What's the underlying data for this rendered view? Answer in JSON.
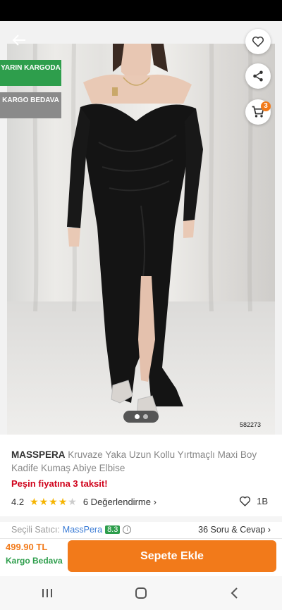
{
  "product": {
    "image_code": "582273",
    "brand": "MASSPERA",
    "name": "Kruvaze Yaka Uzun Kollu Yırtmaçlı Maxi Boy Kadife Kumaş Abiye Elbise",
    "installment_note": "Peşin fiyatına 3 taksit!",
    "rating": "4.2",
    "stars_filled": 4,
    "stars_total": 5,
    "review_count_label": "6 Değerlendirme",
    "favorites": "1B",
    "seller_label": "Seçili Satıcı:",
    "seller_name": "MassPera",
    "seller_score": "8.3",
    "qa_label": "36 Soru & Cevap"
  },
  "badges": {
    "fast_delivery": "YARIN KARGODA",
    "free_shipping": "KARGO BEDAVA"
  },
  "cart": {
    "count": "3"
  },
  "gallery": {
    "total": 2,
    "active_index": 0
  },
  "purchase": {
    "price": "499.90 TL",
    "shipping": "Kargo Bedava",
    "add_to_cart": "Sepete Ekle"
  },
  "icons": {
    "back": "back-arrow-icon",
    "favorite": "heart-icon",
    "share": "share-icon",
    "cart": "cart-icon"
  },
  "colors": {
    "accent": "#f27a1a",
    "success": "#2e9e4c",
    "danger": "#d0021b",
    "link": "#3a7bd5"
  }
}
